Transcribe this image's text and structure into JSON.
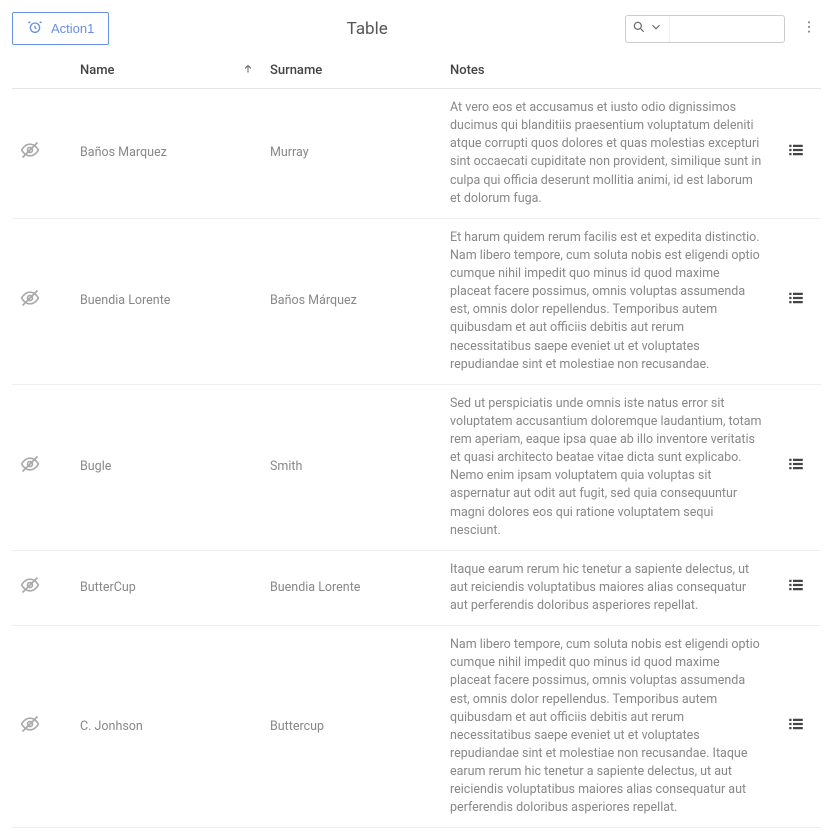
{
  "toolbar": {
    "action1_label": "Action1",
    "title": "Table",
    "search_placeholder": ""
  },
  "columns": {
    "name": "Name",
    "surname": "Surname",
    "notes": "Notes"
  },
  "rows": [
    {
      "name": "Baños Marquez",
      "surname": "Murray",
      "notes": "At vero eos et accusamus et iusto odio dignissimos ducimus qui blanditiis praesentium voluptatum deleniti atque corrupti quos dolores et quas molestias excepturi sint occaecati cupiditate non provident, similique sunt in culpa qui officia deserunt mollitia animi, id est laborum et dolorum fuga."
    },
    {
      "name": "Buendia Lorente",
      "surname": "Baños Márquez",
      "notes": "Et harum quidem rerum facilis est et expedita distinctio. Nam libero tempore, cum soluta nobis est eligendi optio cumque nihil impedit quo minus id quod maxime placeat facere possimus, omnis voluptas assumenda est, omnis dolor repellendus. Temporibus autem quibusdam et aut officiis debitis aut rerum necessitatibus saepe eveniet ut et voluptates repudiandae sint et molestiae non recusandae."
    },
    {
      "name": "Bugle",
      "surname": "Smith",
      "notes": "Sed ut perspiciatis unde omnis iste natus error sit voluptatem accusantium doloremque laudantium, totam rem aperiam, eaque ipsa quae ab illo inventore veritatis et quasi architecto beatae vitae dicta sunt explicabo. Nemo enim ipsam voluptatem quia voluptas sit aspernatur aut odit aut fugit, sed quia consequuntur magni dolores eos qui ratione voluptatem sequi nesciunt."
    },
    {
      "name": "ButterCup",
      "surname": "Buendia Lorente",
      "notes": "Itaque earum rerum hic tenetur a sapiente delectus, ut aut reiciendis voluptatibus maiores alias consequatur aut perferendis doloribus asperiores repellat."
    },
    {
      "name": "C. Jonhson",
      "surname": "Buttercup",
      "notes": "Nam libero tempore, cum soluta nobis est eligendi optio cumque nihil impedit quo minus id quod maxime placeat facere possimus, omnis voluptas assumenda est, omnis dolor repellendus. Temporibus autem quibusdam et aut officiis debitis aut rerum necessitatibus saepe eveniet ut et voluptates repudiandae sint et molestiae non recusandae. Itaque earum rerum hic tenetur a sapiente delectus, ut aut reiciendis voluptatibus maiores alias consequatur aut perferendis doloribus asperiores repellat."
    }
  ]
}
